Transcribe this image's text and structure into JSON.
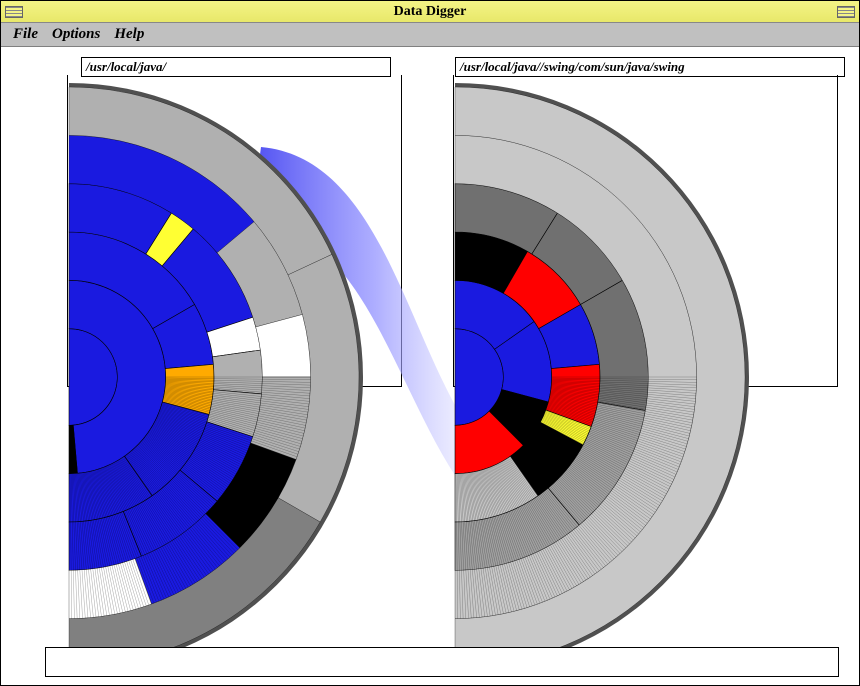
{
  "window": {
    "title": "Data Digger"
  },
  "menu": {
    "file": "File",
    "options": "Options",
    "help": "Help"
  },
  "paths": {
    "left": "/usr/local/java/",
    "right": "/usr/local/java//swing/com/sun/java/swing"
  },
  "status": "",
  "chart_data": [
    {
      "type": "sunburst",
      "title": "/usr/local/java/",
      "rings": 6,
      "root_path": "/usr/local/java/",
      "palette": {
        "primary": "#1a1ae0",
        "highlight": "#ffaa00",
        "accent": "#ffff33",
        "neutral": "#b0b0b0",
        "neutral_dark": "#808080",
        "empty": "#ffffff",
        "line": "#000000"
      },
      "segments_estimated": [
        {
          "ring": 1,
          "start": -90,
          "end": 90,
          "color": "primary"
        },
        {
          "ring": 2,
          "start": -90,
          "end": 85,
          "color": "primary"
        },
        {
          "ring": 2,
          "start": 85,
          "end": 90,
          "color": "line"
        },
        {
          "ring": 3,
          "start": -90,
          "end": -30,
          "color": "primary"
        },
        {
          "ring": 3,
          "start": -30,
          "end": -5,
          "color": "primary"
        },
        {
          "ring": 3,
          "start": -5,
          "end": 15,
          "color": "highlight"
        },
        {
          "ring": 3,
          "start": 15,
          "end": 55,
          "color": "primary"
        },
        {
          "ring": 3,
          "start": 55,
          "end": 90,
          "color": "primary"
        },
        {
          "ring": 4,
          "start": -90,
          "end": -58,
          "color": "primary"
        },
        {
          "ring": 4,
          "start": -58,
          "end": -50,
          "color": "accent"
        },
        {
          "ring": 4,
          "start": -50,
          "end": -18,
          "color": "primary"
        },
        {
          "ring": 4,
          "start": -18,
          "end": -8,
          "color": "empty"
        },
        {
          "ring": 4,
          "start": -8,
          "end": 5,
          "color": "neutral"
        },
        {
          "ring": 4,
          "start": 5,
          "end": 18,
          "color": "neutral"
        },
        {
          "ring": 4,
          "start": 18,
          "end": 40,
          "color": "primary"
        },
        {
          "ring": 4,
          "start": 40,
          "end": 68,
          "color": "primary"
        },
        {
          "ring": 4,
          "start": 68,
          "end": 90,
          "color": "primary"
        },
        {
          "ring": 5,
          "start": -90,
          "end": -40,
          "color": "primary"
        },
        {
          "ring": 5,
          "start": -40,
          "end": -15,
          "color": "neutral"
        },
        {
          "ring": 5,
          "start": -15,
          "end": 0,
          "color": "empty"
        },
        {
          "ring": 5,
          "start": 0,
          "end": 20,
          "color": "neutral"
        },
        {
          "ring": 5,
          "start": 20,
          "end": 45,
          "color": "line"
        },
        {
          "ring": 5,
          "start": 45,
          "end": 70,
          "color": "primary"
        },
        {
          "ring": 5,
          "start": 70,
          "end": 90,
          "color": "empty"
        },
        {
          "ring": 6,
          "start": -90,
          "end": -25,
          "color": "neutral"
        },
        {
          "ring": 6,
          "start": -25,
          "end": 30,
          "color": "neutral"
        },
        {
          "ring": 6,
          "start": 30,
          "end": 90,
          "color": "neutral_dark"
        }
      ]
    },
    {
      "type": "sunburst",
      "title": "/usr/local/java//swing/com/sun/java/swing",
      "rings": 6,
      "root_path": "/usr/local/java//swing/com/sun/java/swing",
      "palette": {
        "primary": "#1a1ae0",
        "red": "#ff0000",
        "accent": "#ffff33",
        "neutral": "#c8c8c8",
        "neutral_mid": "#a0a0a0",
        "neutral_dark": "#707070",
        "line": "#000000"
      },
      "segments_estimated": [
        {
          "ring": 1,
          "start": -90,
          "end": 90,
          "color": "primary"
        },
        {
          "ring": 2,
          "start": -90,
          "end": -35,
          "color": "primary"
        },
        {
          "ring": 2,
          "start": -35,
          "end": 15,
          "color": "primary"
        },
        {
          "ring": 2,
          "start": 15,
          "end": 45,
          "color": "line"
        },
        {
          "ring": 2,
          "start": 45,
          "end": 90,
          "color": "red"
        },
        {
          "ring": 3,
          "start": -90,
          "end": -60,
          "color": "line"
        },
        {
          "ring": 3,
          "start": -60,
          "end": -30,
          "color": "red"
        },
        {
          "ring": 3,
          "start": -30,
          "end": -5,
          "color": "primary"
        },
        {
          "ring": 3,
          "start": -5,
          "end": 20,
          "color": "red"
        },
        {
          "ring": 3,
          "start": 20,
          "end": 28,
          "color": "accent"
        },
        {
          "ring": 3,
          "start": 28,
          "end": 55,
          "color": "line"
        },
        {
          "ring": 3,
          "start": 55,
          "end": 90,
          "color": "neutral"
        },
        {
          "ring": 4,
          "start": -90,
          "end": -58,
          "color": "neutral_dark"
        },
        {
          "ring": 4,
          "start": -58,
          "end": -30,
          "color": "neutral_dark"
        },
        {
          "ring": 4,
          "start": -30,
          "end": 10,
          "color": "neutral_dark"
        },
        {
          "ring": 4,
          "start": 10,
          "end": 50,
          "color": "neutral_mid"
        },
        {
          "ring": 4,
          "start": 50,
          "end": 90,
          "color": "neutral_mid"
        },
        {
          "ring": 5,
          "start": -90,
          "end": 90,
          "color": "neutral"
        },
        {
          "ring": 6,
          "start": -90,
          "end": 90,
          "color": "neutral"
        }
      ]
    }
  ]
}
